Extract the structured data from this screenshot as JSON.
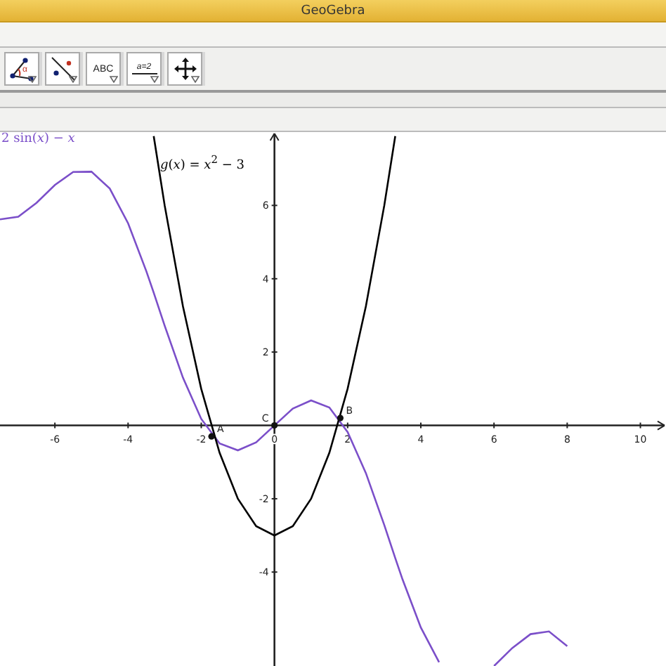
{
  "window": {
    "title": "GeoGebra"
  },
  "toolbar": {
    "tools": [
      {
        "kind": "angle",
        "label": "α"
      },
      {
        "kind": "line"
      },
      {
        "kind": "text",
        "label": "ABC"
      },
      {
        "kind": "slider",
        "label": "a=2"
      },
      {
        "kind": "move"
      }
    ]
  },
  "graphics": {
    "chart_data": {
      "type": "line",
      "x": [
        -7.5,
        -7,
        -6.5,
        -6,
        -5.5,
        -5,
        -4.5,
        -4,
        -3.5,
        -3.3,
        -3,
        -2.5,
        -2,
        -1.5,
        -1,
        -0.5,
        0,
        0.5,
        1,
        1.5,
        2,
        2.5,
        3,
        3.3,
        3.5,
        4,
        4.5,
        6,
        6.5,
        7,
        7.5,
        8
      ],
      "series": [
        {
          "name": "2 sin(*x*) − *x*",
          "color": "#7b4fc9",
          "values": [
            5.62,
            5.69,
            6.07,
            6.56,
            6.91,
            6.92,
            6.46,
            5.51,
            4.2,
            3.62,
            2.72,
            1.3,
            0.18,
            -0.49,
            -0.68,
            -0.46,
            0,
            0.46,
            0.68,
            0.49,
            -0.18,
            -1.3,
            -2.72,
            -3.62,
            -4.2,
            -5.51,
            -6.46,
            -6.56,
            -6.07,
            -5.69,
            -5.62,
            -6.02
          ]
        },
        {
          "name": "*g*(*x*) = *x*$^{2}$ − 3",
          "color": "#000000",
          "values": [
            null,
            null,
            null,
            null,
            null,
            null,
            null,
            null,
            null,
            7.89,
            6,
            3.25,
            1,
            -0.75,
            -2,
            -2.75,
            -3,
            -2.75,
            -2,
            -0.75,
            1,
            3.25,
            6,
            7.89,
            null,
            null,
            null,
            null,
            null,
            null,
            null,
            null
          ]
        }
      ],
      "xlim": [
        -7.5,
        10.7
      ],
      "ylim": [
        -6.6,
        8
      ],
      "xticks": [
        {
          "value": -6,
          "label": "-6"
        },
        {
          "value": -4,
          "label": "-4"
        },
        {
          "value": -2,
          "label": "-2"
        },
        {
          "value": 0,
          "label": "0"
        },
        {
          "value": 2,
          "label": "2"
        },
        {
          "value": 4,
          "label": "4"
        },
        {
          "value": 6,
          "label": "6"
        },
        {
          "value": 8,
          "label": "8"
        },
        {
          "value": 10,
          "label": "10"
        }
      ],
      "yticks": [
        {
          "value": -4,
          "label": "-4"
        },
        {
          "value": -2,
          "label": "-2"
        },
        {
          "value": 2,
          "label": "2"
        },
        {
          "value": 4,
          "label": "4"
        },
        {
          "value": 6,
          "label": "6"
        }
      ],
      "annotations": [
        {
          "text": "A",
          "x": -1.72,
          "y": -0.3
        },
        {
          "text": "B",
          "x": 1.8,
          "y": 0.2
        },
        {
          "text": "C",
          "x": 0,
          "y": 0
        }
      ]
    }
  }
}
